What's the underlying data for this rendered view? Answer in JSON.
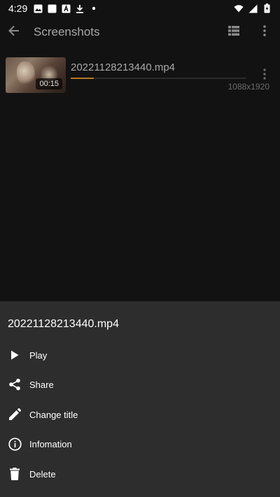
{
  "status_bar": {
    "time": "4:29",
    "left_icons": [
      "image-icon",
      "square-icon",
      "a-icon",
      "download-icon",
      "dot-icon"
    ],
    "right_icons": [
      "wifi-icon",
      "signal-icon",
      "battery-icon"
    ]
  },
  "app_bar": {
    "title": "Screenshots",
    "back_icon": "arrow-left-icon",
    "view_icon": "list-view-icon",
    "menu_icon": "more-vert-icon"
  },
  "video": {
    "duration": "00:15",
    "file_name": "20221128213440.mp4",
    "resolution": "1088x1920",
    "progress": 0.13,
    "accent": "#b57a1f"
  },
  "sheet": {
    "title": "20221128213440.mp4",
    "items": [
      {
        "label": "Play",
        "icon": "play-icon"
      },
      {
        "label": "Share",
        "icon": "share-icon"
      },
      {
        "label": "Change title",
        "icon": "edit-icon"
      },
      {
        "label": "Infomation",
        "icon": "info-icon"
      },
      {
        "label": "Delete",
        "icon": "delete-icon"
      }
    ]
  }
}
